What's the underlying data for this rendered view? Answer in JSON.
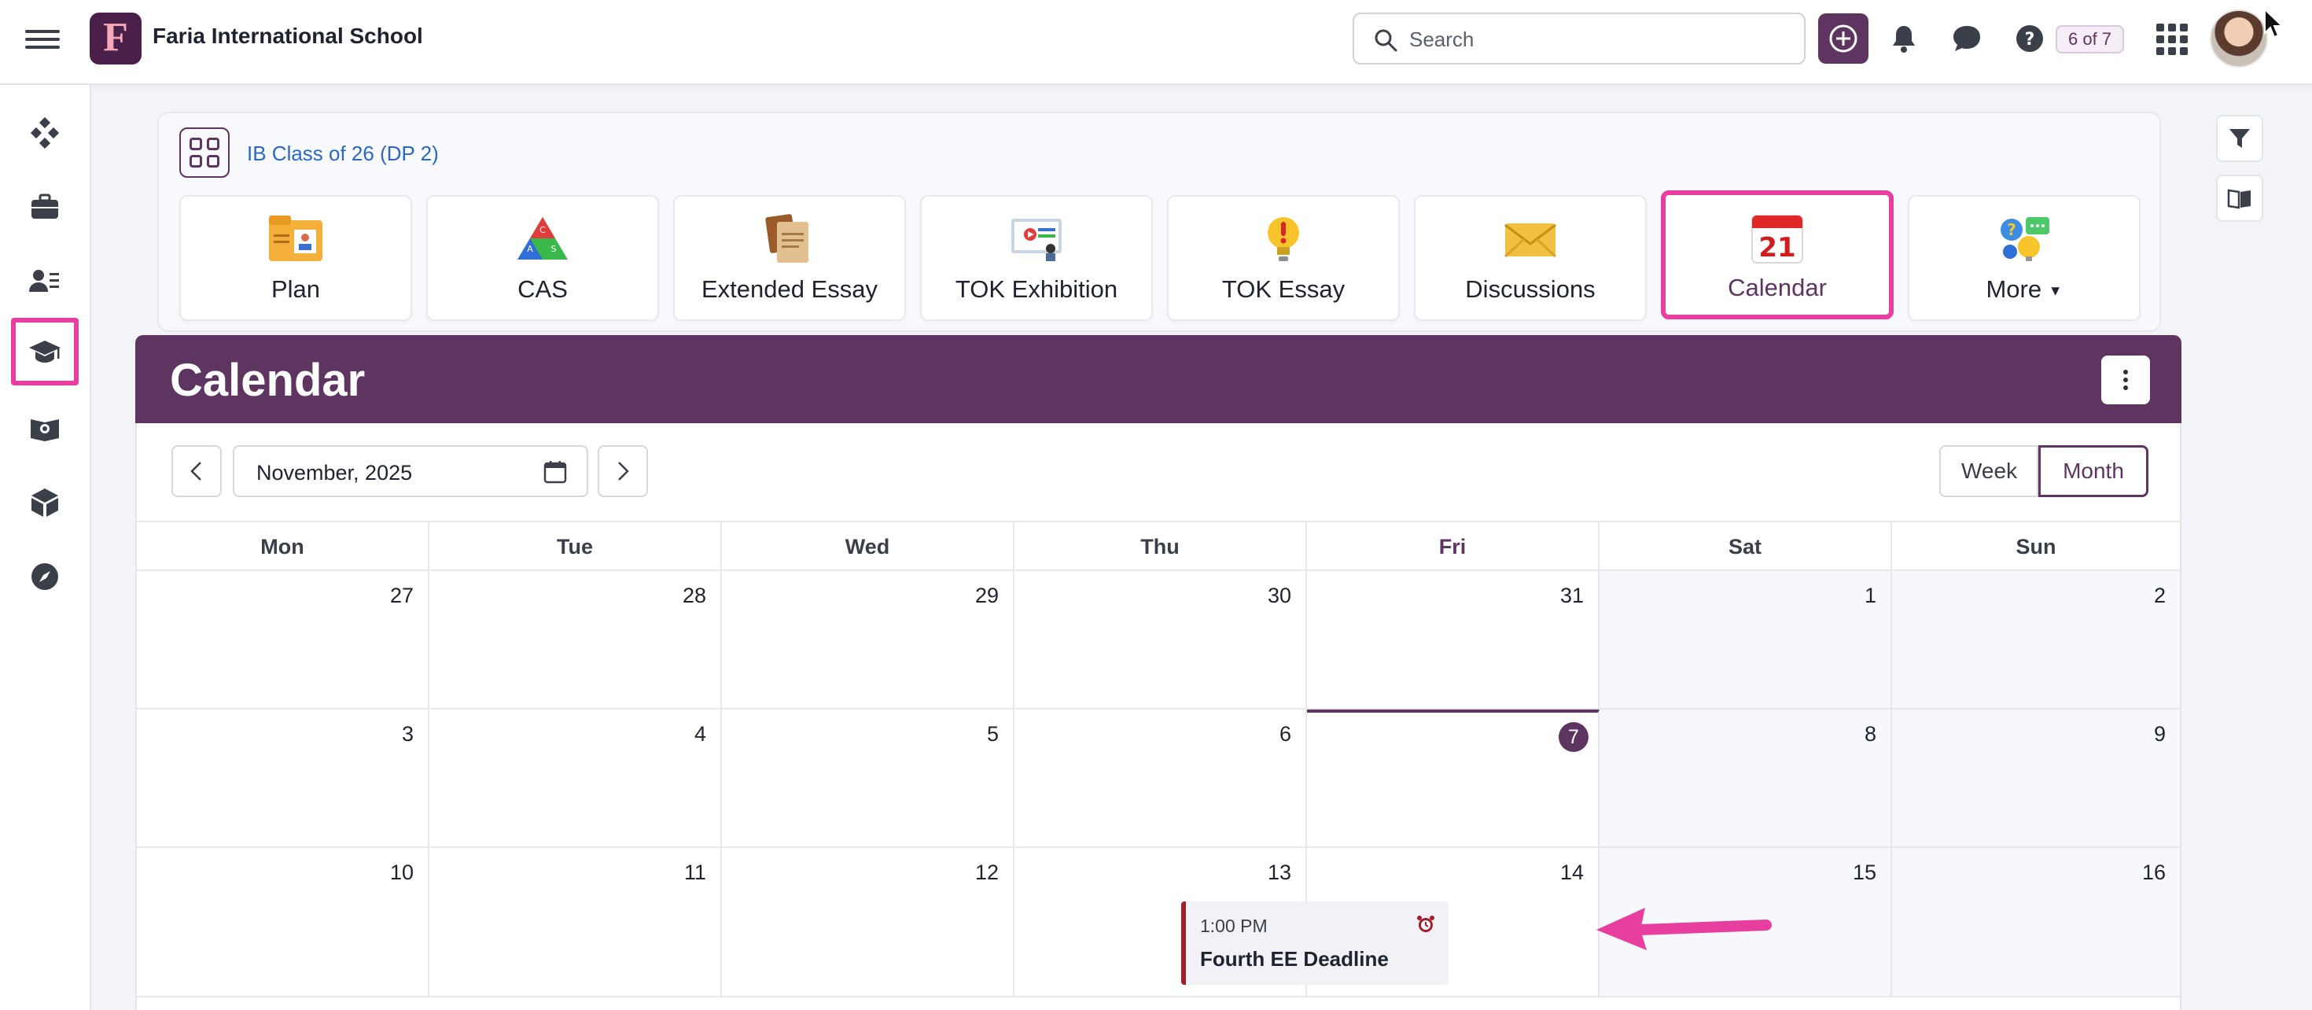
{
  "topbar": {
    "school_name": "Faria International School",
    "logo_letter": "F",
    "search_placeholder": "Search",
    "counter": "6 of 7"
  },
  "class": {
    "name": "IB Class of 26 (DP 2)"
  },
  "tiles": [
    {
      "label": "Plan",
      "icon": "plan-icon"
    },
    {
      "label": "CAS",
      "icon": "cas-icon"
    },
    {
      "label": "Extended Essay",
      "icon": "extended-essay-icon"
    },
    {
      "label": "TOK Exhibition",
      "icon": "tok-exhibition-icon"
    },
    {
      "label": "TOK Essay",
      "icon": "tok-essay-icon"
    },
    {
      "label": "Discussions",
      "icon": "discussions-icon"
    },
    {
      "label": "Calendar",
      "icon": "calendar-21-icon",
      "active": true,
      "icon_text": "21"
    },
    {
      "label": "More",
      "icon": "more-icon"
    }
  ],
  "calendar": {
    "title": "Calendar",
    "period": "November, 2025",
    "views": {
      "week": "Week",
      "month": "Month",
      "selected": "Month"
    },
    "days_of_week": [
      "Mon",
      "Tue",
      "Wed",
      "Thu",
      "Fri",
      "Sat",
      "Sun"
    ],
    "weeks": [
      [
        "27",
        "28",
        "29",
        "30",
        "31",
        "1",
        "2"
      ],
      [
        "3",
        "4",
        "5",
        "6",
        "7",
        "8",
        "9"
      ],
      [
        "10",
        "11",
        "12",
        "13",
        "14",
        "15",
        "16"
      ]
    ],
    "today": "7",
    "event": {
      "time": "1:00 PM",
      "title": "Fourth EE Deadline",
      "color": "#a11f2a"
    }
  },
  "colors": {
    "brand": "#5e3560",
    "highlight": "#e83e9f",
    "link": "#2a68c4"
  }
}
